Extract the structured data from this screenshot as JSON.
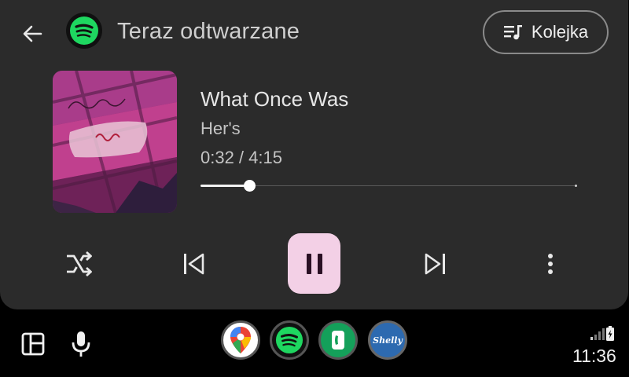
{
  "header": {
    "title": "Teraz odtwarzane",
    "back_icon": "arrow-left-icon",
    "app_icon": "spotify-icon",
    "queue_label": "Kolejka",
    "queue_icon": "queue-music-icon"
  },
  "track": {
    "title": "What Once Was",
    "artist": "Her's",
    "time_display": "0:32 / 4:15",
    "progress_fraction": 0.13
  },
  "controls": {
    "shuffle_icon": "shuffle-icon",
    "previous_icon": "skip-previous-icon",
    "pause_icon": "pause-icon",
    "next_icon": "skip-next-icon",
    "more_icon": "more-vert-icon"
  },
  "bottom_bar": {
    "dashboard_icon": "dashboard-icon",
    "mic_icon": "microphone-icon",
    "apps": [
      {
        "name": "Google Maps",
        "icon": "maps-icon"
      },
      {
        "name": "Spotify",
        "icon": "spotify-icon"
      },
      {
        "name": "Phone",
        "icon": "phone-icon"
      },
      {
        "name": "Shelly",
        "icon": "shelly-icon",
        "text": "Shelly"
      }
    ],
    "time": "11:36",
    "signal_icon": "signal-icon",
    "battery_icon": "battery-charging-icon"
  },
  "colors": {
    "card_bg": "#2b2b2b",
    "accent_pause": "#f3d0e6",
    "spotify_green": "#1ed760",
    "phone_green": "#14a05a",
    "shelly_blue": "#2d6ab0"
  }
}
